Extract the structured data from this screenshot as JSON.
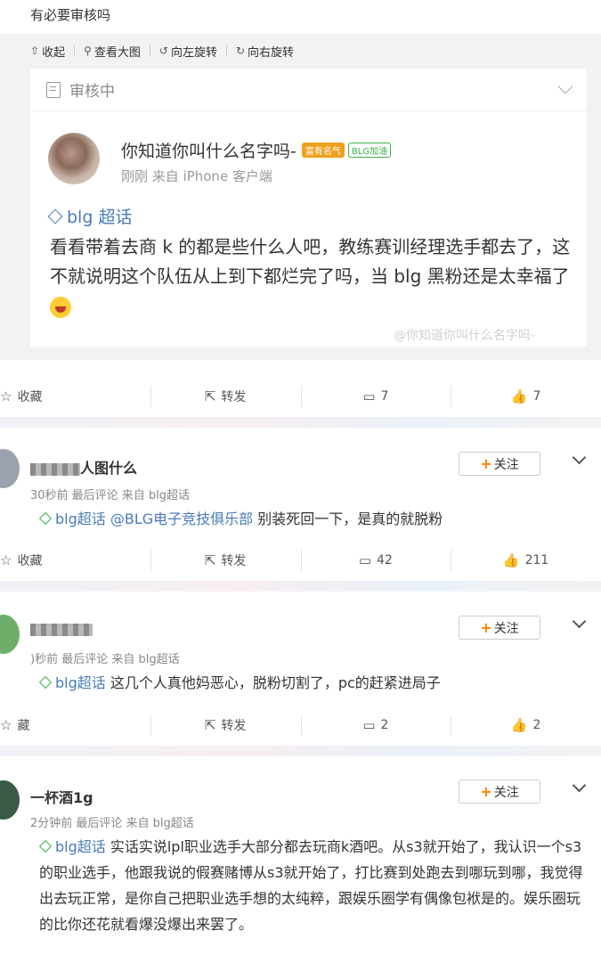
{
  "header": {
    "title": "有必要审核吗"
  },
  "toolbar": {
    "collapse": "收起",
    "view_large": "查看大图",
    "rotate_left": "向左旋转",
    "rotate_right": "向右旋转"
  },
  "card": {
    "status": "审核中",
    "username": "你知道你叫什么名字吗-",
    "badge1": "富有名气",
    "badge2": "BLG加油",
    "meta": "刚刚  来自 iPhone 客户端",
    "topic": "blg 超话",
    "text": "看看带着去商 k 的都是些什么人吧，教练赛训经理选手都去了，这不就说明这个队伍从上到下都烂完了吗，当 blg 黑粉还是太幸福了",
    "watermark": "@你知道你叫什么名字吗-"
  },
  "post_actions": {
    "favorite": "收藏",
    "repost": "转发",
    "comments": "7",
    "likes": "7"
  },
  "comments": [
    {
      "name": "人图什么",
      "meta": "30秒前 最后评论 来自 blg超话",
      "topic": "blg超话",
      "mention": "@BLG电子竞技俱乐部",
      "text": " 别装死回一下，是真的就脱粉",
      "follow": "关注",
      "actions": {
        "favorite": "收藏",
        "repost": "转发",
        "comments": "42",
        "likes": "211"
      }
    },
    {
      "name": "",
      "meta": ")秒前 最后评论 来自 blg超话",
      "topic": "blg超话",
      "text": " 这几个人真他妈恶心，脱粉切割了，pc的赶紧进局子",
      "follow": "关注",
      "actions": {
        "favorite": "藏",
        "repost": "转发",
        "comments": "2",
        "likes": "2"
      }
    },
    {
      "name": "一杯酒1g",
      "meta": "2分钟前 最后评论 来自 blg超话",
      "topic": "blg超话",
      "text": " 实话实说lpl职业选手大部分都去玩商k酒吧。从s3就开始了，我认识一个s3的职业选手，他跟我说的假赛赌博从s3就开始了，打比赛到处跑去到哪玩到哪，我觉得出去玩正常，是你自己把职业选手想的太纯粹，跟娱乐圈学有偶像包袱是的。娱乐圈玩的比你还花就看爆没爆出来罢了。",
      "follow": "关注"
    }
  ],
  "colors": {
    "link": "#4a7ab8",
    "accent": "#ff8200",
    "green": "#3bb34a"
  }
}
